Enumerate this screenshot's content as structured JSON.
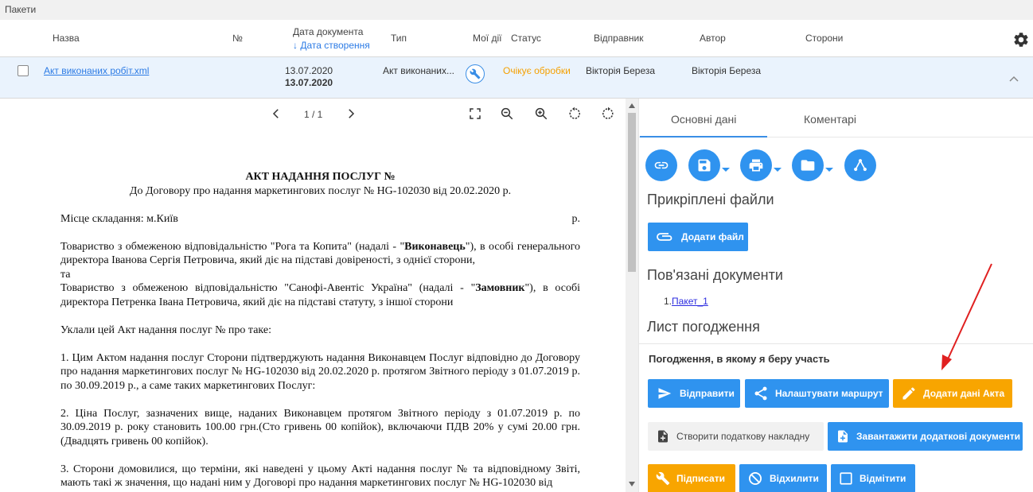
{
  "topbar": {
    "title": "Пакети"
  },
  "table": {
    "headers": {
      "name": "Назва",
      "number": "№",
      "doc_date": "Дата документа",
      "created_date": "↓ Дата створення",
      "type": "Тип",
      "my_actions": "Мої дії",
      "status": "Статус",
      "sender": "Відправник",
      "author": "Автор",
      "parties": "Сторони"
    },
    "row": {
      "name": "Акт виконаних робіт.xml",
      "doc_date": "13.07.2020",
      "created_date": "13.07.2020",
      "type": "Акт виконаних...",
      "status": "Очікує обробки",
      "sender": "Вікторія Береза",
      "author": "Вікторія Береза"
    },
    "icons": {
      "settings": "gear-icon",
      "action": "wrench-icon",
      "collapse": "chevron-up-icon"
    }
  },
  "viewer": {
    "page_indicator": "1 / 1",
    "document": {
      "title": "АКТ НАДАННЯ ПОСЛУГ №",
      "subtitle": "До Договору про надання маркетингових послуг № HG-102030 від 20.02.2020 р.",
      "place_label": "Місце складання: м.Київ",
      "place_suffix": "р.",
      "p1_a": "Товариство з обмеженою відповідальністю \"Рога та Копита\" (надалі - \"",
      "p1_bold": "Виконавець",
      "p1_b": "\"), в особі генерального директора Іванова Сергія Петровича, який діє на підставі довіреності, з однієї сторони,",
      "p1_and": "та",
      "p2_a": "Товариство з обмеженою відповідальністю \"Санофі-Авентіс Україна\" (надалі - \"",
      "p2_bold": "Замовник",
      "p2_b": "\"), в особі директора Петренка Івана Петровича, який діє на підставі статуту, з іншої сторони",
      "p3": "Уклали цей Акт надання послуг № про таке:",
      "p4": "1. Цим Актом надання послуг Сторони підтверджують надання Виконавцем Послуг відповідно до Договору про надання маркетингових послуг № HG-102030 від 20.02.2020 р. протягом Звітного періоду з 01.07.2019 р. по 30.09.2019 р., а саме таких маркетингових Послуг:",
      "p5": "2. Ціна Послуг, зазначених вище, наданих Виконавцем протягом Звітного періоду з 01.07.2019 р. по 30.09.2019 р. року становить 100.00 грн.(Сто гривень 00 копійок), включаючи ПДВ 20% у сумі 20.00 грн. (Двадцять гривень 00 копійок).",
      "p6": "3. Сторони домовилися, що терміни, які наведені у цьому Акті надання послуг № та відповідному Звіті, мають такі ж значення, що надані ним у Договорі про надання маркетингових послуг № HG-102030 від"
    }
  },
  "panel": {
    "tabs": {
      "main": "Основні дані",
      "comments": "Коментарі"
    },
    "attached_title": "Прикріплені файли",
    "add_file": "Додати файл",
    "related_title": "Пов'язані документи",
    "related_prefix": "1.",
    "related_link": "Пакет_1",
    "approval_title": "Лист погодження",
    "participation_title": "Погодження, в якому я беру участь",
    "buttons": {
      "send": "Відправити",
      "route": "Налаштувати маршрут",
      "add_act": "Додати дані Акта",
      "tax_invoice": "Створити податкову накладну",
      "upload_docs": "Завантажити додаткові документи",
      "sign": "Підписати",
      "reject": "Відхилити",
      "mark": "Відмітити"
    },
    "colors": {
      "primary": "#2f93ef",
      "warning": "#f8a500",
      "annotation": "#e02020"
    }
  }
}
